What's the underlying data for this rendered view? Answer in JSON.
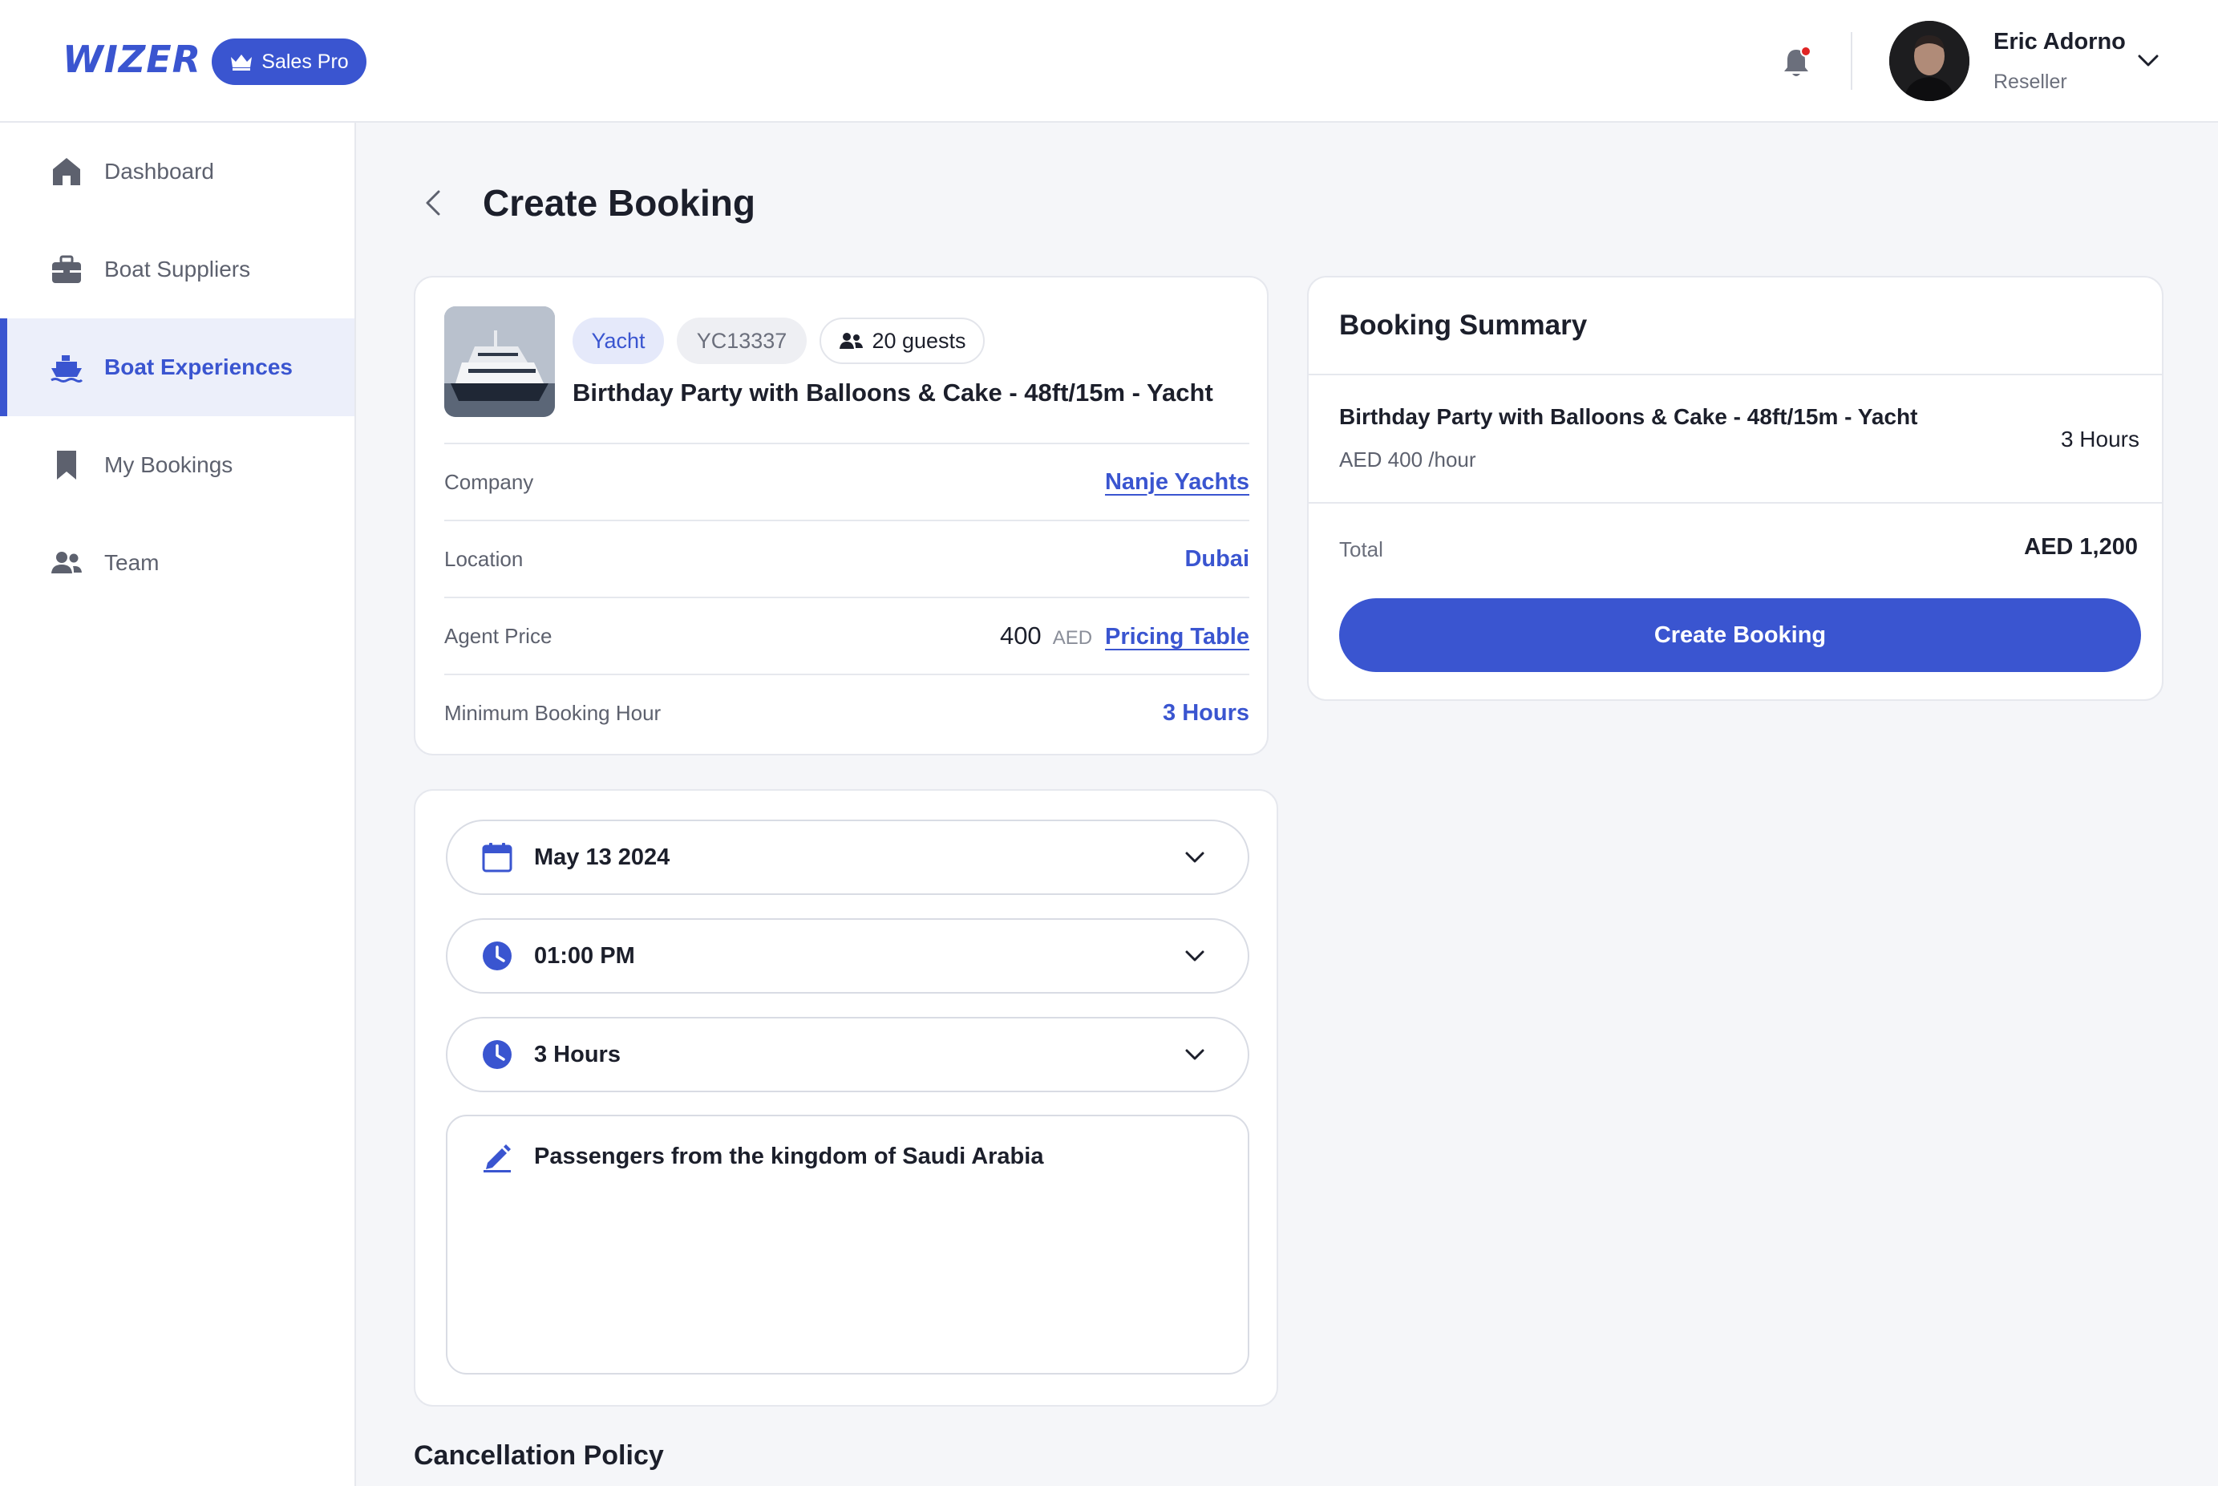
{
  "brand": {
    "logo": "WIZER",
    "plan": "Sales Pro",
    "accent": "#3a55d0"
  },
  "user": {
    "name": "Eric Adorno",
    "role": "Reseller"
  },
  "sidebar": {
    "items": [
      {
        "label": "Dashboard",
        "icon": "home-icon"
      },
      {
        "label": "Boat Suppliers",
        "icon": "briefcase-icon"
      },
      {
        "label": "Boat Experiences",
        "icon": "ship-icon",
        "active": true
      },
      {
        "label": "My Bookings",
        "icon": "bookmark-icon"
      },
      {
        "label": "Team",
        "icon": "users-icon"
      }
    ]
  },
  "page": {
    "title": "Create Booking"
  },
  "experience": {
    "type": "Yacht",
    "code": "YC13337",
    "guests": "20 guests",
    "title": "Birthday Party with Balloons & Cake - 48ft/15m - Yacht",
    "company_label": "Company",
    "company": "Nanje Yachts",
    "location_label": "Location",
    "location": "Dubai",
    "price_label": "Agent Price",
    "price": "400",
    "price_unit": "AED",
    "pricing_link": "Pricing Table",
    "min_label": "Minimum Booking Hour",
    "min_hours": "3 Hours"
  },
  "form": {
    "date": "May 13 2024",
    "time": "01:00 PM",
    "duration": "3 Hours",
    "notes": "Passengers from the kingdom of Saudi Arabia"
  },
  "cancellation": {
    "title": "Cancellation Policy"
  },
  "summary": {
    "title": "Booking Summary",
    "item_name": "Birthday Party with Balloons & Cake - 48ft/15m - Yacht",
    "item_rate": "AED 400 /hour",
    "item_hours": "3 Hours",
    "total_label": "Total",
    "total_value": "AED 1,200",
    "button": "Create Booking"
  }
}
